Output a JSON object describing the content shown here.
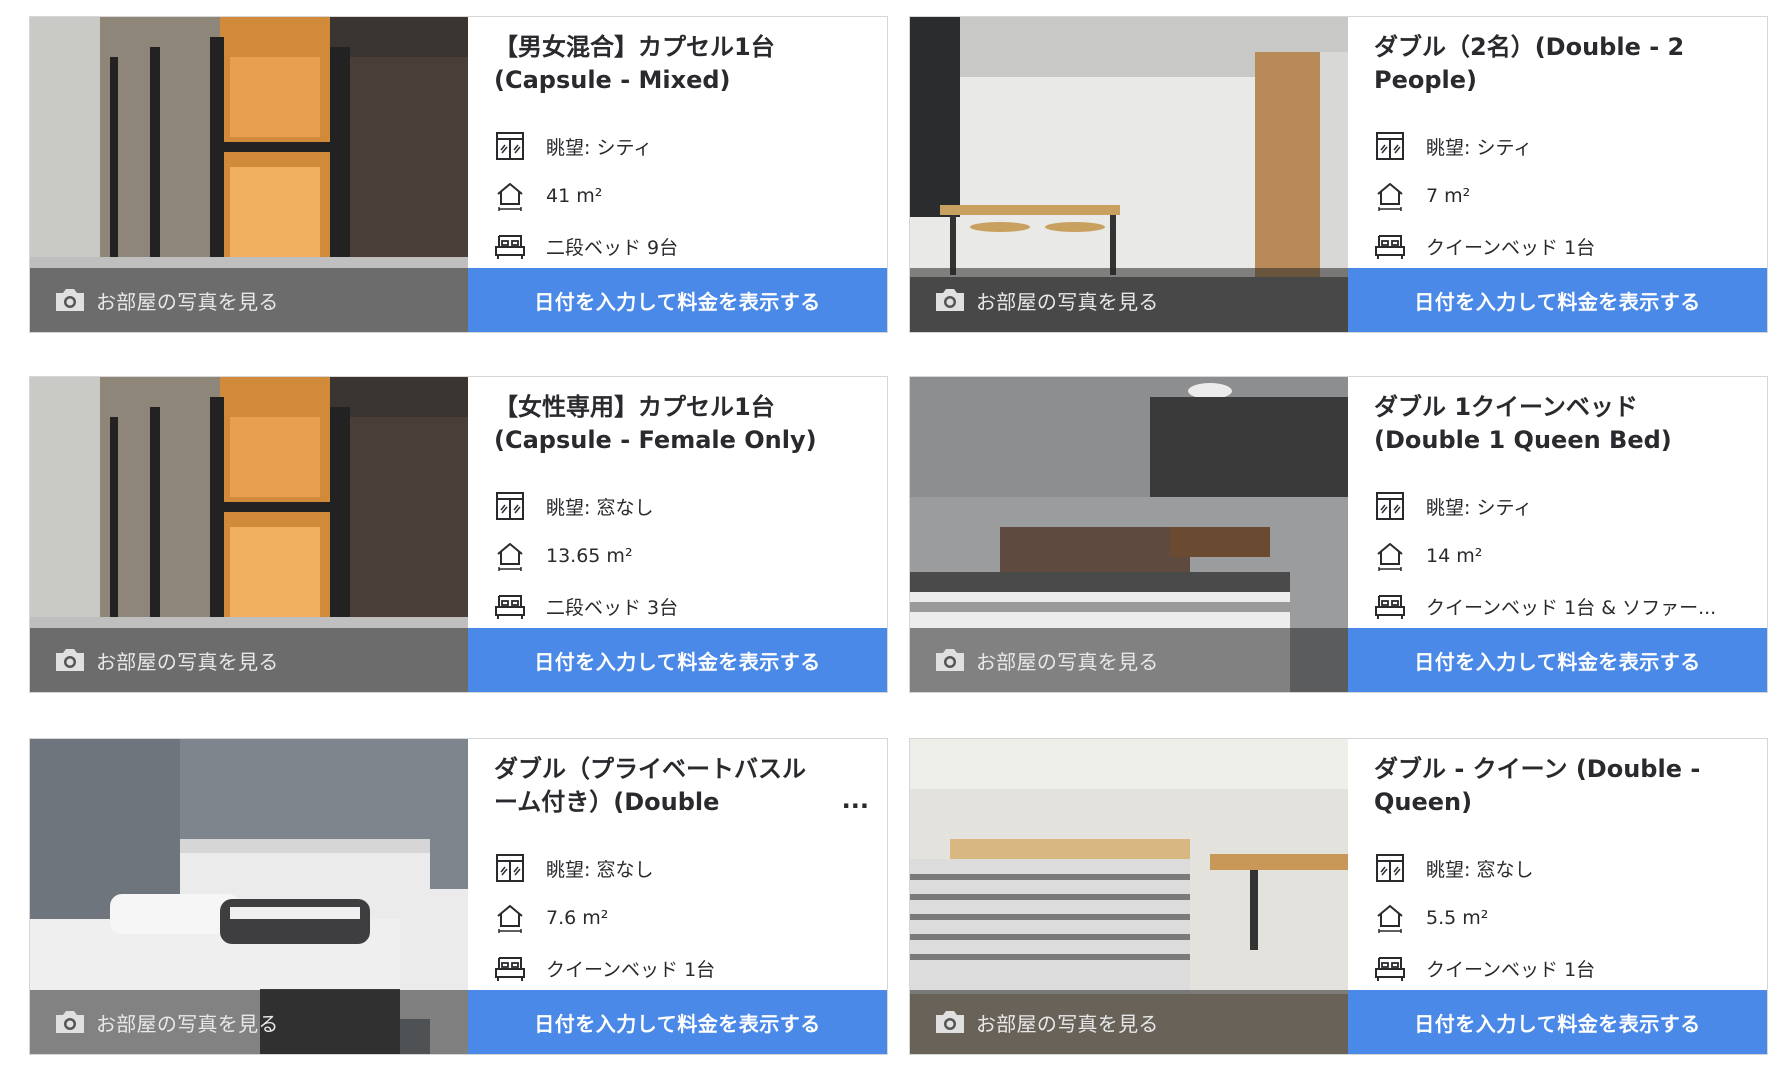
{
  "photo_link_label": "お部屋の写真を見る",
  "cta_label": "日付を入力して料金を表示する",
  "colors": {
    "cta": "#4a89e8",
    "photo_overlay": "rgba(40,40,40,0.55)"
  },
  "icons": {
    "view": "window-view-icon",
    "area": "house-area-icon",
    "bed": "bed-icon",
    "photo": "camera-icon"
  },
  "rooms": [
    {
      "title": "【男女混合】カプセル1台 (Capsule - Mixed)",
      "view": "眺望: シティ",
      "size": "41 m²",
      "beds": "二段ベッド 9台"
    },
    {
      "title": "ダブル（2名）(Double - 2 People)",
      "view": "眺望: シティ",
      "size": "7 m²",
      "beds": "クイーンベッド 1台"
    },
    {
      "title": "【女性専用】カプセル1台 (Capsule - Female Only)",
      "view": "眺望: 窓なし",
      "size": "13.65 m²",
      "beds": "二段ベッド 3台"
    },
    {
      "title": "ダブル 1クイーンベッド (Double 1 Queen Bed)",
      "view": "眺望: シティ",
      "size": "14 m²",
      "beds": "クイーンベッド 1台 & ソファー..."
    },
    {
      "title": "ダブル（プライベートバスルーム付き）(Double (Private",
      "ellipsis": "...",
      "view": "眺望: 窓なし",
      "size": "7.6 m²",
      "beds": "クイーンベッド 1台"
    },
    {
      "title": "ダブル - クイーン (Double - Queen)",
      "view": "眺望: 窓なし",
      "size": "5.5 m²",
      "beds": "クイーンベッド 1台"
    }
  ]
}
